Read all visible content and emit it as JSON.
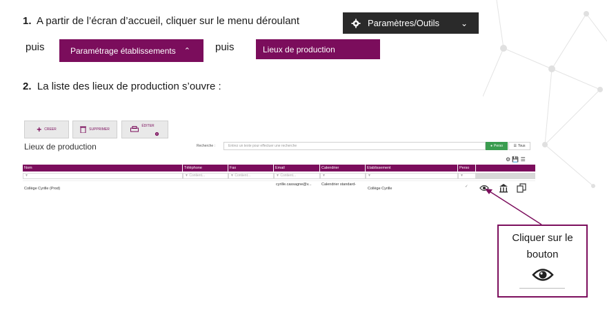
{
  "colors": {
    "plum": "#7b0d5c",
    "dark_menu": "#2a2a2a",
    "green": "#3a9c4f"
  },
  "step1": {
    "number": "1.",
    "text": "A partir de l’écran d’accueil, cliquer sur le menu déroulant"
  },
  "dark_menu": {
    "label": "Paramètres/Outils",
    "icon": "gear-icon"
  },
  "puis": "puis",
  "btn_parametrage": {
    "label": "Paramétrage établissements"
  },
  "btn_lieux": {
    "label": "Lieux de production"
  },
  "step2": {
    "number": "2.",
    "text": "La liste des lieux de production s’ouvre :"
  },
  "screenshot": {
    "toolbar": {
      "creer": "CREER",
      "supprimer": "SUPPRIMER",
      "editer": "ÉDITER"
    },
    "title": "Lieux de production",
    "search_label": "Recherche :",
    "search_placeholder": "Entrez un texte pour effectuer une recherche",
    "perso": "Perso",
    "tous": "Tous",
    "columns": [
      "Nom",
      "Téléphone",
      "Fax",
      "Email",
      "Calendrier",
      "Etablissement",
      "Perso"
    ],
    "filter_placeholder": "Contient...",
    "row": {
      "nom": "Collège Cyrille (Prod)",
      "email": "cyrille.cassagne@v...",
      "calendrier": "Calendrier standard-",
      "etablissement": "Collège Cyrille",
      "perso": "✓"
    }
  },
  "callout": {
    "line1": "Cliquer sur le",
    "line2": "bouton",
    "icon": "eye-icon"
  }
}
